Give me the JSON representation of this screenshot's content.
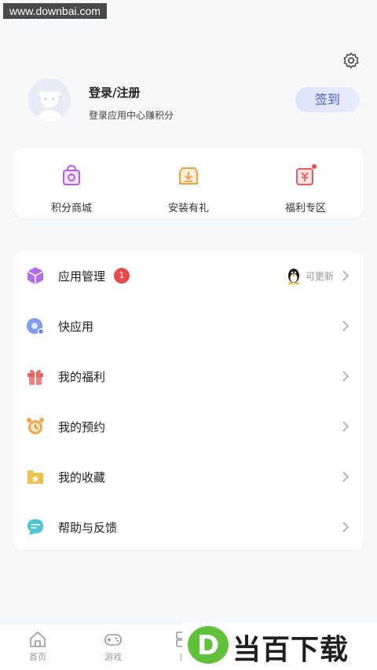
{
  "watermark": {
    "url_text": "www.downbai.com",
    "brand_text": "当百下载",
    "brand_letter": "D"
  },
  "header": {
    "settings_icon": "gear-icon"
  },
  "profile": {
    "title": "登录/注册",
    "subtitle": "登录应用中心赚积分",
    "signin_label": "签到"
  },
  "quick_links": [
    {
      "label": "积分商城",
      "icon": "shopping-bag-icon",
      "color": "#b45be8"
    },
    {
      "label": "安装有礼",
      "icon": "download-box-icon",
      "color": "#f0a33a"
    },
    {
      "label": "福利专区",
      "icon": "gift-yen-icon",
      "color": "#e85b5b"
    }
  ],
  "menu": [
    {
      "label": "应用管理",
      "icon": "cube-icon",
      "color": "#b26de8",
      "badge": "1",
      "extra": "可更新"
    },
    {
      "label": "快应用",
      "icon": "quick-app-icon",
      "color": "#6f8ff0"
    },
    {
      "label": "我的福利",
      "icon": "gift-icon",
      "color": "#ef6060"
    },
    {
      "label": "我的预约",
      "icon": "alarm-clock-icon",
      "color": "#f3a74c"
    },
    {
      "label": "我的收藏",
      "icon": "star-folder-icon",
      "color": "#eec24a"
    },
    {
      "label": "帮助与反馈",
      "icon": "chat-bubble-icon",
      "color": "#4cc4d6"
    }
  ],
  "tabbar": [
    {
      "label": "首页",
      "icon": "home-icon"
    },
    {
      "label": "游戏",
      "icon": "gamepad-icon"
    },
    {
      "label": "应",
      "icon": "apps-icon"
    }
  ]
}
